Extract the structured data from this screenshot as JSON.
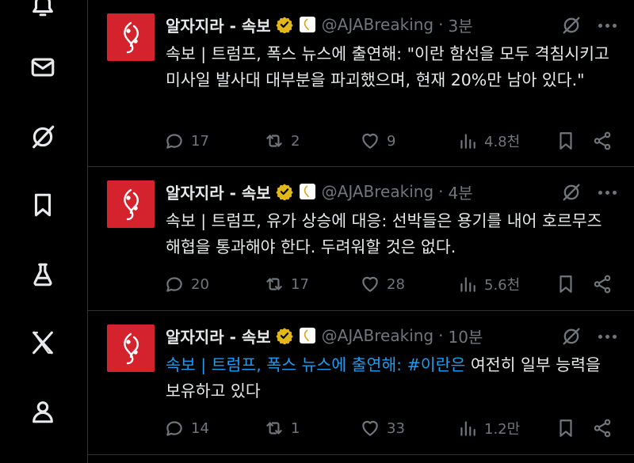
{
  "sidebar": {
    "items": [
      {
        "name": "notifications-icon"
      },
      {
        "name": "mail-icon"
      },
      {
        "name": "grok-icon"
      },
      {
        "name": "bookmark-icon"
      },
      {
        "name": "labs-flask-icon"
      },
      {
        "name": "x-logo-icon"
      },
      {
        "name": "profile-icon"
      }
    ]
  },
  "tweets": [
    {
      "name": "알자지라 - 속보",
      "handle": "@AJABreaking",
      "dot": "·",
      "time": "3분",
      "text_parts": [
        "속보 | 트럼프, 폭스 뉴스에 출연해: \"이란 함선을 모두 격침시키고 미사일 발사대 대부분을 파괴했으며, 현재 20%만 남아 있다.\""
      ],
      "replies": "17",
      "reposts": "2",
      "likes": "9",
      "views": "4.8천"
    },
    {
      "name": "알자지라 - 속보",
      "handle": "@AJABreaking",
      "dot": "·",
      "time": "4분",
      "text_parts": [
        "속보 | 트럼프, 유가 상승에 대응: 선박들은 용기를 내어 호르무즈 해협을 통과해야 한다. 두려워할 것은 없다."
      ],
      "replies": "20",
      "reposts": "17",
      "likes": "28",
      "views": "5.6천"
    },
    {
      "name": "알자지라 - 속보",
      "handle": "@AJABreaking",
      "dot": "·",
      "time": "10분",
      "text_link": "속보 | 트럼프, 폭스 뉴스에 출연해: #이란은",
      "text_rest": " 여전히 일부 능력을 보유하고 있다",
      "replies": "14",
      "reposts": "1",
      "likes": "33",
      "views": "1.2만"
    }
  ],
  "colors": {
    "background": "#000000",
    "text": "#e7e9ea",
    "muted": "#71767b",
    "link": "#1d9bf0",
    "avatar": "#d4232c",
    "verified": "#e2b719",
    "divider": "#2f3336"
  }
}
